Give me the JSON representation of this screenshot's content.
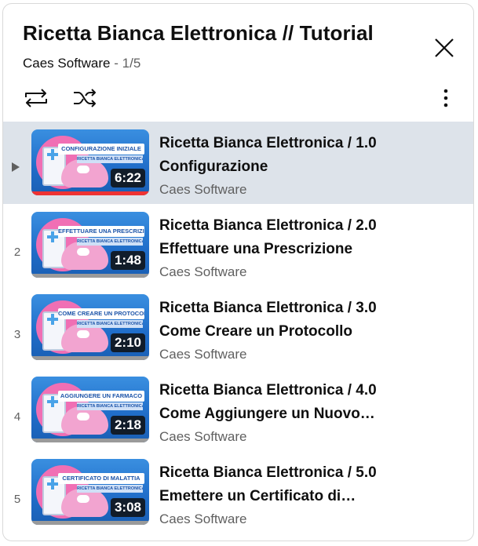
{
  "playlist": {
    "title": "Ricetta Bianca Elettronica // Tutorial",
    "channel": "Caes Software",
    "separator": "-",
    "position": "1/5"
  },
  "controls": {
    "loop_icon": "loop-icon",
    "shuffle_icon": "shuffle-icon",
    "more_icon": "more-vert-icon",
    "close_icon": "close-icon"
  },
  "items": [
    {
      "index": "",
      "line1": "Ricetta Bianca Elettronica / 1.0",
      "line2": "Configurazione",
      "channel": "Caes Software",
      "duration": "6:22",
      "thumb_label": "CONFIGURAZIONE INIZIALE",
      "thumb_sub": "RICETTA BIANCA ELETTRONICA",
      "active": true
    },
    {
      "index": "2",
      "line1": "Ricetta Bianca Elettronica / 2.0",
      "line2": "Effettuare una Prescrizione",
      "channel": "Caes Software",
      "duration": "1:48",
      "thumb_label": "EFFETTUARE UNA PRESCRIZIONE",
      "thumb_sub": "RICETTA BIANCA ELETTRONICA",
      "active": false
    },
    {
      "index": "3",
      "line1": "Ricetta Bianca Elettronica / 3.0",
      "line2": "Come Creare un Protocollo",
      "channel": "Caes Software",
      "duration": "2:10",
      "thumb_label": "COME CREARE UN PROTOCOLLO",
      "thumb_sub": "RICETTA BIANCA ELETTRONICA",
      "active": false
    },
    {
      "index": "4",
      "line1": "Ricetta Bianca Elettronica / 4.0",
      "line2": "Come Aggiungere un Nuovo…",
      "channel": "Caes Software",
      "duration": "2:18",
      "thumb_label": "AGGIUNGERE UN FARMACO",
      "thumb_sub": "RICETTA BIANCA ELETTRONICA",
      "active": false
    },
    {
      "index": "5",
      "line1": "Ricetta Bianca Elettronica / 5.0",
      "line2": "Emettere un Certificato di…",
      "channel": "Caes Software",
      "duration": "3:08",
      "thumb_label": "CERTIFICATO DI MALATTIA",
      "thumb_sub": "RICETTA BIANCA ELETTRONICA",
      "active": false
    }
  ],
  "colors": {
    "active_row": "#dde3ea",
    "progress_watched": "#e33333",
    "secondary_text": "#606060"
  }
}
